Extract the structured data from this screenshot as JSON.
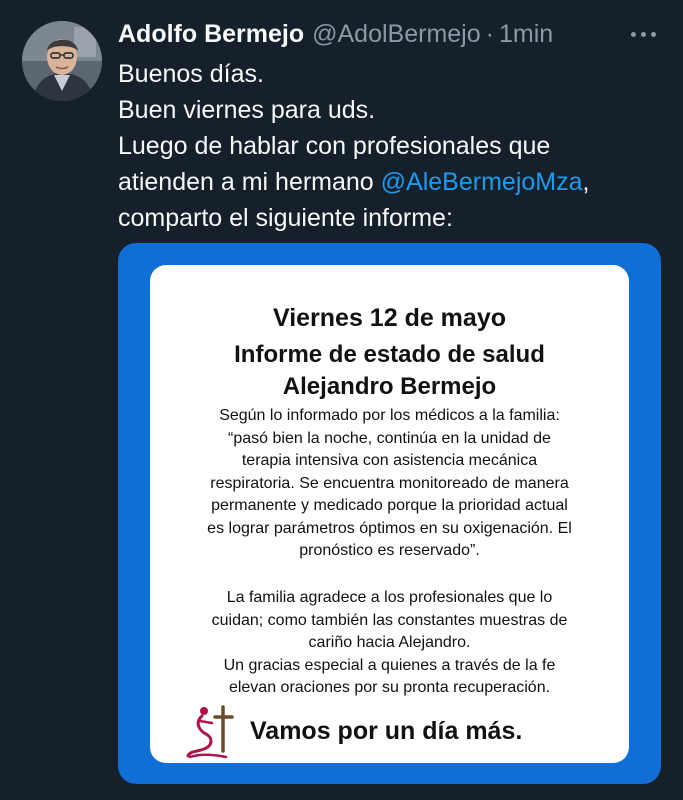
{
  "tweet": {
    "author": {
      "display_name": "Adolfo Bermejo",
      "handle": "@AdolBermejo",
      "separator": "·",
      "timestamp": "1min",
      "avatar": "profile-photo"
    },
    "more_icon": "more-horizontal-icon",
    "text": {
      "line1": "Buenos días.",
      "line2": "Buen viernes para uds.",
      "line3": "Luego de hablar con profesionales que",
      "line4_before": "atienden a mi hermano ",
      "line4_mention": "@AleBermejoMza",
      "line4_after": ",",
      "line5": "comparto el siguiente informe:"
    },
    "image": {
      "date": "Viernes 12 de mayo",
      "title_line1": "Informe de estado de salud",
      "title_line2": "Alejandro Bermejo",
      "paragraph1": [
        "Según lo informado por los médicos a la familia:",
        "“pasó bien la noche, continúa en la unidad de",
        "terapia intensiva con asistencia mecánica",
        "respiratoria. Se encuentra monitoreado de manera",
        "permanente y medicado porque la prioridad actual",
        "es lograr parámetros óptimos en su oxigenación. El",
        "pronóstico es reservado”."
      ],
      "paragraph2": [
        "La familia agradece a los profesionales que lo",
        "cuidan;  como también las constantes muestras de",
        "cariño hacia Alejandro.",
        "Un gracias especial a quienes a través de la fe",
        "elevan oraciones por su pronta recuperación."
      ],
      "signoff": "Vamos por un día más.",
      "signoff_logo": "praying-figure-cross-logo"
    },
    "colors": {
      "background": "#15202b",
      "text": "#f7f9f9",
      "secondary_text": "#8b98a5",
      "link": "#1d9bf0",
      "image_frame": "#0f6fd6"
    }
  }
}
